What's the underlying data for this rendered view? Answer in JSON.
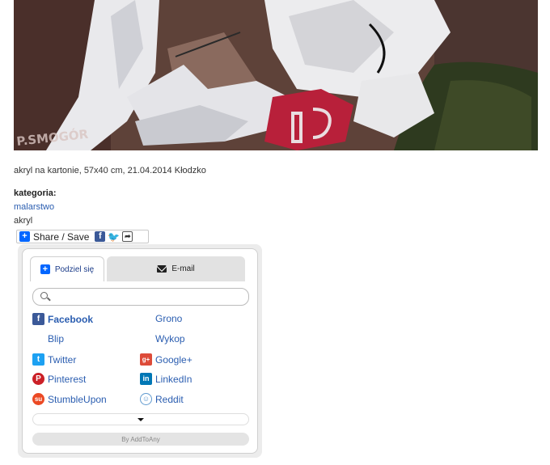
{
  "caption": "akryl na kartonie, 57x40 cm, 21.04.2014 Kłodzko",
  "category": {
    "label": "kategoria:",
    "items": [
      "malarstwo",
      "akryl"
    ]
  },
  "share_button": {
    "label": "Share / Save"
  },
  "popup": {
    "tabs": {
      "share": "Podziel się",
      "email": "E-mail"
    },
    "search_placeholder": "",
    "services": [
      {
        "name": "Facebook",
        "icon": "facebook-icon",
        "color": "#3b5998"
      },
      {
        "name": "Grono",
        "icon": "",
        "color": ""
      },
      {
        "name": "Blip",
        "icon": "",
        "color": ""
      },
      {
        "name": "Wykop",
        "icon": "",
        "color": ""
      },
      {
        "name": "Twitter",
        "icon": "twitter-icon",
        "color": "#1da1f2"
      },
      {
        "name": "Google+",
        "icon": "google-plus-icon",
        "color": "#dd4b39"
      },
      {
        "name": "Pinterest",
        "icon": "pinterest-icon",
        "color": "#cb2027"
      },
      {
        "name": "LinkedIn",
        "icon": "linkedin-icon",
        "color": "#0077b5"
      },
      {
        "name": "StumbleUpon",
        "icon": "stumbleupon-icon",
        "color": "#eb4924"
      },
      {
        "name": "Reddit",
        "icon": "reddit-icon",
        "color": "#5f99cf"
      }
    ],
    "footer": "By AddToAny"
  },
  "colors": {
    "accent": "#2a5db0",
    "addtoany_blue": "#0166ff"
  }
}
